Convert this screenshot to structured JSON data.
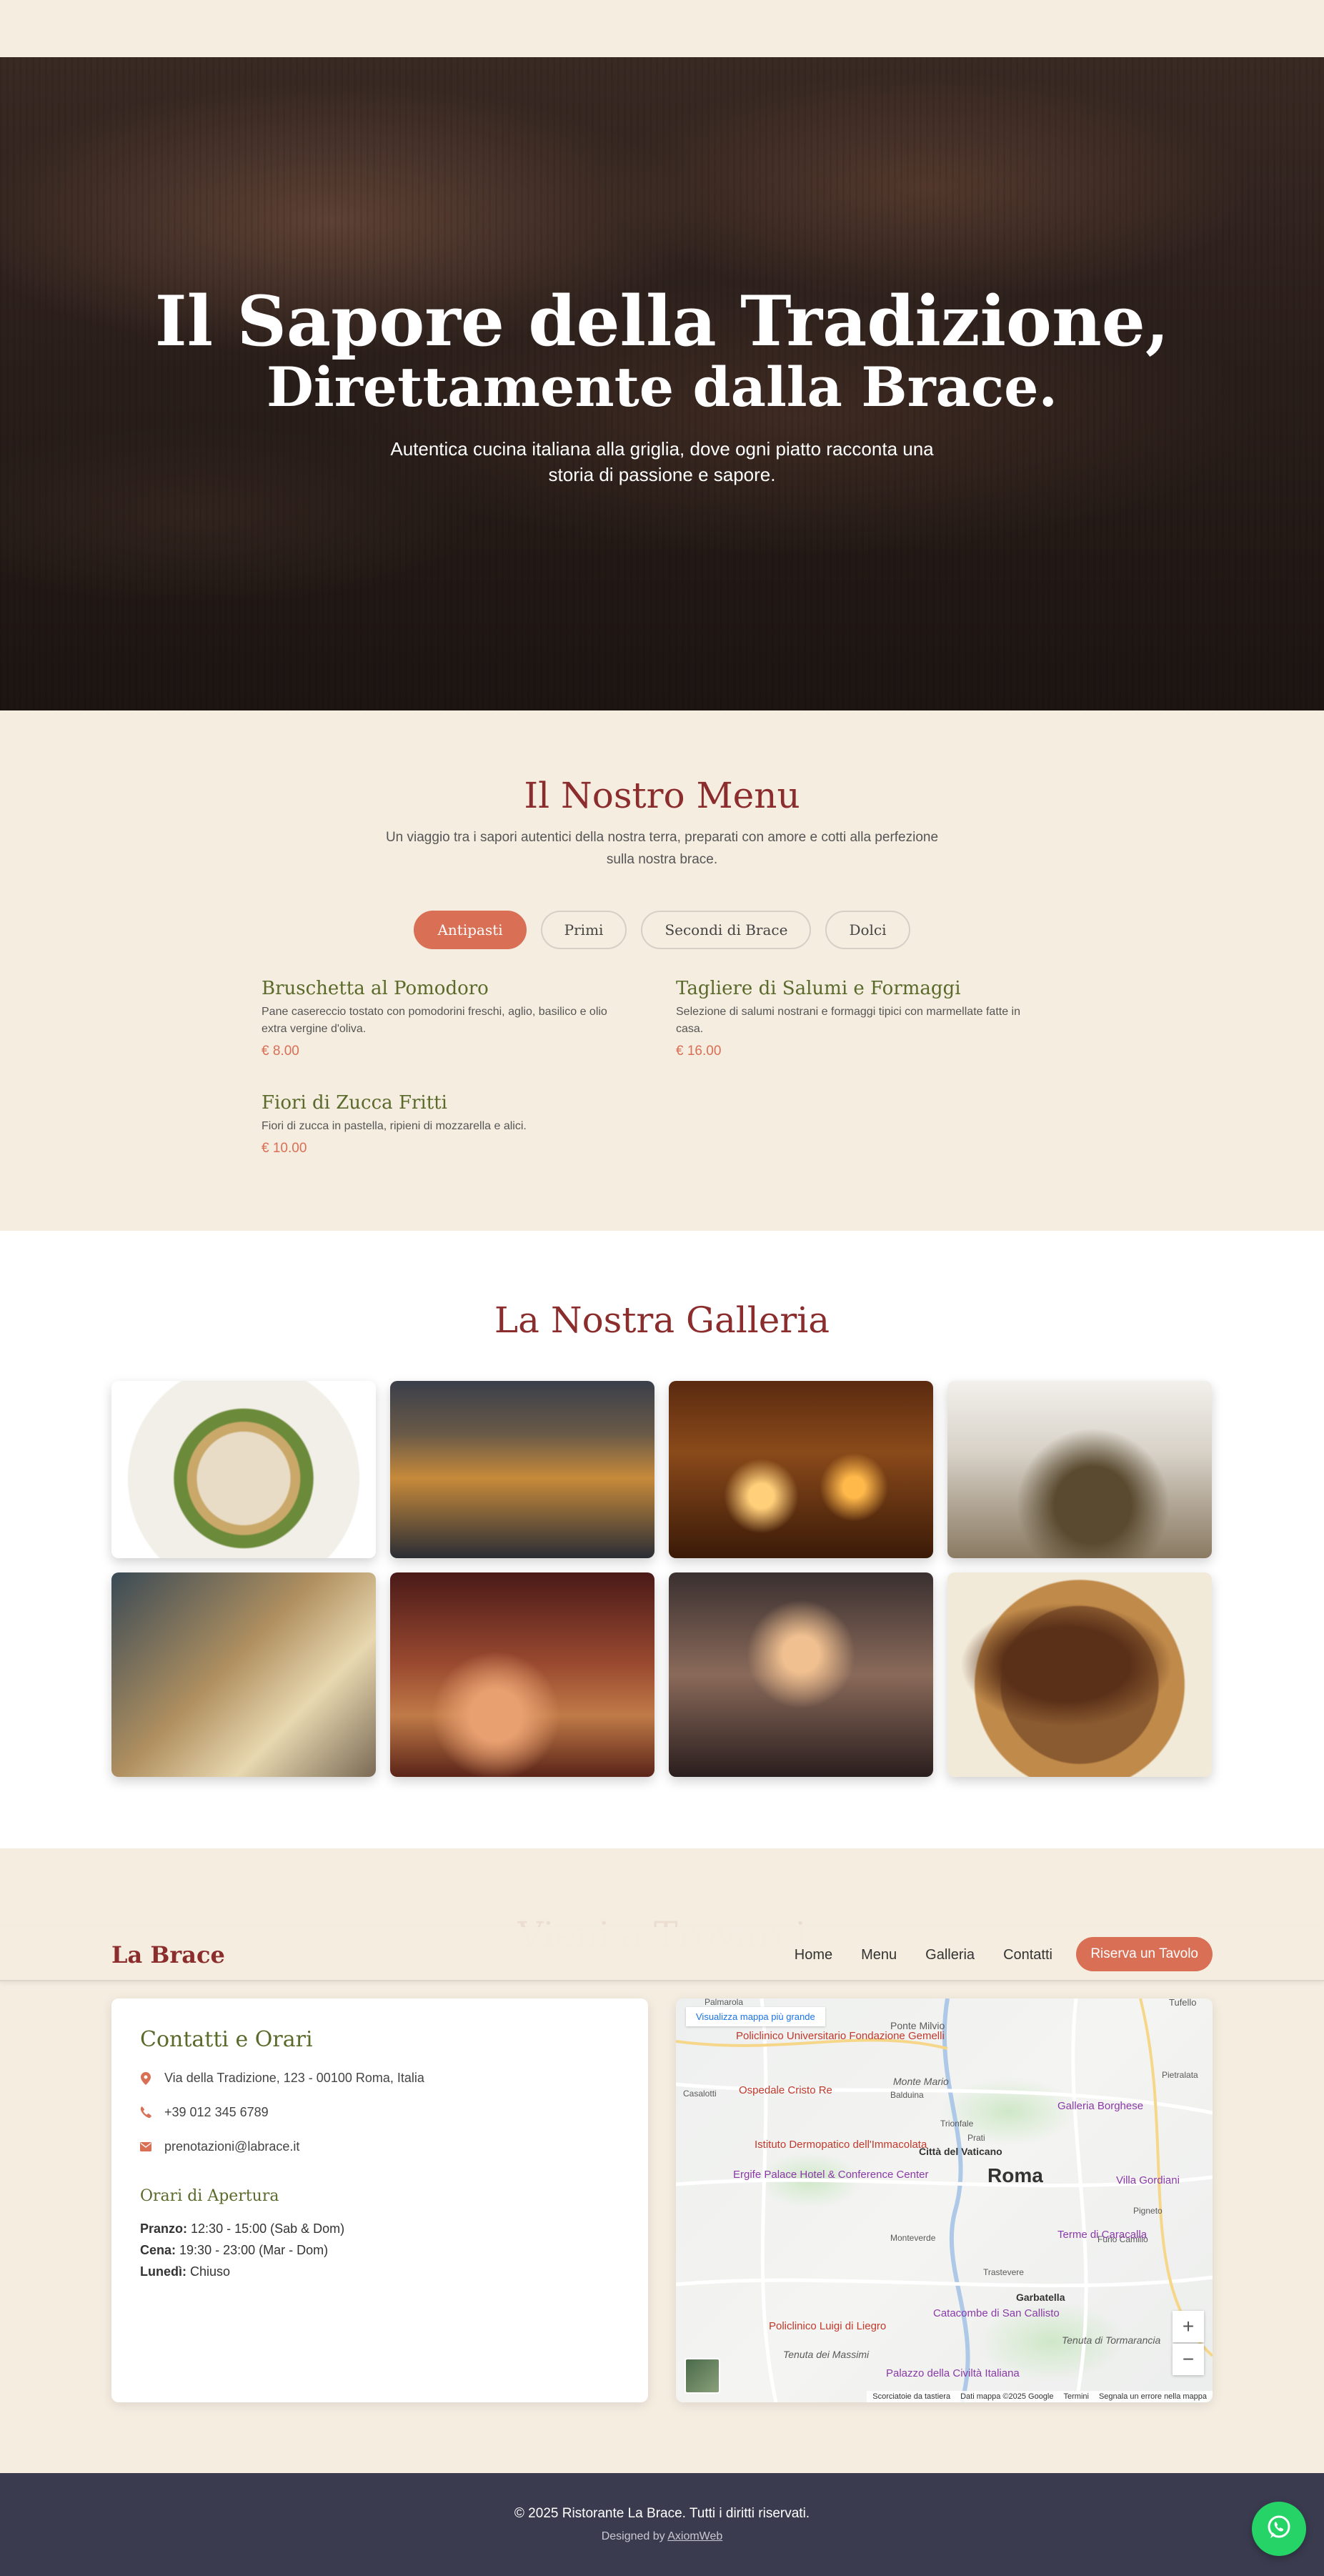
{
  "hero": {
    "title_line1": "Il Sapore della Tradizione,",
    "title_line2": "Direttamente dalla Brace.",
    "subtitle": "Autentica cucina italiana alla griglia, dove ogni piatto racconta una storia di passione e sapore."
  },
  "menu": {
    "title": "Il Nostro Menu",
    "intro": "Un viaggio tra i sapori autentici della nostra terra, preparati con amore e cotti alla perfezione sulla nostra brace.",
    "tabs": [
      {
        "label": "Antipasti",
        "active": true
      },
      {
        "label": "Primi",
        "active": false
      },
      {
        "label": "Secondi di Brace",
        "active": false
      },
      {
        "label": "Dolci",
        "active": false
      }
    ],
    "items": [
      {
        "name": "Bruschetta al Pomodoro",
        "description": "Pane casereccio tostato con pomodorini freschi, aglio, basilico e olio extra vergine d'oliva.",
        "price": "€ 8.00"
      },
      {
        "name": "Tagliere di Salumi e Formaggi",
        "description": "Selezione di salumi nostrani e formaggi tipici con marmellate fatte in casa.",
        "price": "€ 16.00"
      },
      {
        "name": "Fiori di Zucca Fritti",
        "description": "Fiori di zucca in pastella, ripieni di mozzarella e alici.",
        "price": "€ 10.00"
      }
    ]
  },
  "gallery": {
    "title": "La Nostra Galleria",
    "images": [
      {
        "name": "clams-pasta-photo"
      },
      {
        "name": "restaurant-interior-photo"
      },
      {
        "name": "wine-candles-photo"
      },
      {
        "name": "chef-plating-photo"
      },
      {
        "name": "fresh-pasta-photo"
      },
      {
        "name": "pastries-tray-photo"
      },
      {
        "name": "friends-toast-photo"
      },
      {
        "name": "grilled-steak-photo"
      }
    ]
  },
  "contact": {
    "section_title": "Vieni a Trovarci",
    "card_title": "Contatti e Orari",
    "address": "Via della Tradizione, 123 - 00100 Roma, Italia",
    "phone": "+39 012 345 6789",
    "email": "prenotazioni@labrace.it",
    "hours_title": "Orari di Apertura",
    "hours": [
      {
        "label": "Pranzo:",
        "value": "12:30 - 15:00 (Sab & Dom)"
      },
      {
        "label": "Cena:",
        "value": "19:30 - 23:00 (Mar - Dom)"
      },
      {
        "label": "Lunedì:",
        "value": "Chiuso"
      }
    ],
    "icons": {
      "address": "map-pin-icon",
      "phone": "phone-icon",
      "email": "envelope-icon"
    }
  },
  "map": {
    "link": "Visualizza mappa più grande",
    "city": "Roma",
    "labels": [
      "Ponte Milvio",
      "Monte Mario",
      "Città del Vaticano",
      "Trastevere",
      "Garbatella",
      "Tenuta di Tormarancia",
      "Tenuta dei Massimi",
      "Casalotti",
      "Balduina",
      "Monteverde",
      "Pigneto",
      "Furio Camillo",
      "Trionfale",
      "Prati",
      "Pietralata",
      "Tufello",
      "Palmarola"
    ],
    "pois": [
      "Policlinico Universitario Fondazione Gemelli",
      "Ospedale Cristo Re",
      "Istituto Dermopatico dell'Immacolata",
      "Ergife Palace Hotel & Conference Center",
      "Galleria Borghese",
      "Villa Gordiani",
      "Terme di Caracalla",
      "Catacombe di San Callisto",
      "Policlinico Luigi di Liegro",
      "Palazzo della Civiltà Italiana"
    ],
    "zoom_in": "+",
    "zoom_out": "−",
    "footer": [
      "Scorciatoie da tastiera",
      "Dati mappa ©2025 Google",
      "Termini",
      "Segnala un errore nella mappa"
    ]
  },
  "navbar": {
    "logo": "La Brace",
    "links": [
      "Home",
      "Menu",
      "Galleria",
      "Contatti"
    ],
    "cta": "Riserva un Tavolo"
  },
  "footer": {
    "copyright": "© 2025 Ristorante La Brace. Tutti i diritti riservati.",
    "designed_prefix": "Designed by",
    "designed_link": "AxiomWeb"
  },
  "colors": {
    "accent": "#d96f55",
    "title": "#8b2d2d",
    "olive": "#5a6a2a",
    "background": "#f5ede0",
    "footer": "#3a3b4f",
    "whatsapp": "#25d366"
  },
  "whatsapp": {
    "icon": "whatsapp-icon"
  }
}
